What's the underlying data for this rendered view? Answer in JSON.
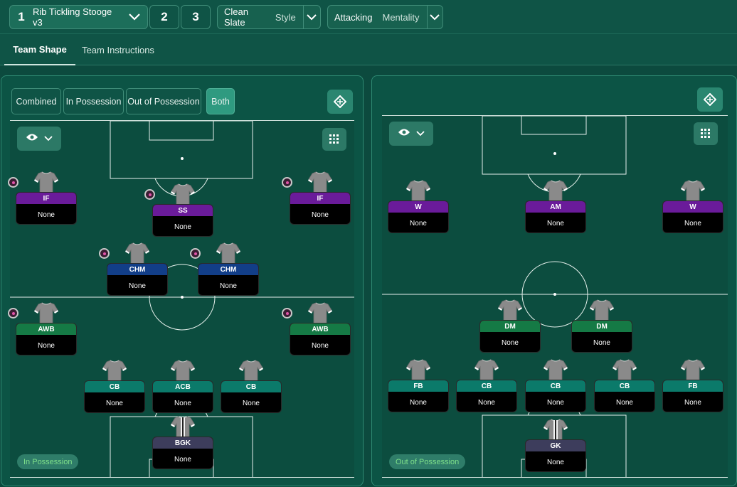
{
  "tactics": {
    "active_number": "1",
    "active_name": "Rib Tickling Stooge v3",
    "slot2": "2",
    "slot3": "3"
  },
  "style": {
    "value": "Clean Slate",
    "label": "Style"
  },
  "mentality": {
    "value": "Attacking",
    "label": "Mentality"
  },
  "tabs": [
    "Team Shape",
    "Team Instructions"
  ],
  "left_panel": {
    "segments": [
      "Combined",
      "In Possession",
      "Out of Possession",
      "Both"
    ],
    "active_segment": "Both",
    "mode_badge": "In Possession",
    "players": [
      {
        "role": "IF",
        "duty": "None",
        "color": "purple",
        "flag": true
      },
      {
        "role": "SS",
        "duty": "None",
        "color": "purple",
        "flag": true
      },
      {
        "role": "IF",
        "duty": "None",
        "color": "purple",
        "flag": true
      },
      {
        "role": "CHM",
        "duty": "None",
        "color": "blue",
        "flag": true
      },
      {
        "role": "CHM",
        "duty": "None",
        "color": "blue",
        "flag": true
      },
      {
        "role": "AWB",
        "duty": "None",
        "color": "green",
        "flag": true
      },
      {
        "role": "AWB",
        "duty": "None",
        "color": "green",
        "flag": true
      },
      {
        "role": "CB",
        "duty": "None",
        "color": "teal",
        "flag": false
      },
      {
        "role": "ACB",
        "duty": "None",
        "color": "teal",
        "flag": false
      },
      {
        "role": "CB",
        "duty": "None",
        "color": "teal",
        "flag": false
      },
      {
        "role": "BGK",
        "duty": "None",
        "color": "slate",
        "flag": false
      }
    ]
  },
  "right_panel": {
    "mode_badge": "Out of Possession",
    "players": [
      {
        "role": "W",
        "duty": "None",
        "color": "purple"
      },
      {
        "role": "AM",
        "duty": "None",
        "color": "purple"
      },
      {
        "role": "W",
        "duty": "None",
        "color": "purple"
      },
      {
        "role": "DM",
        "duty": "None",
        "color": "green"
      },
      {
        "role": "DM",
        "duty": "None",
        "color": "green"
      },
      {
        "role": "FB",
        "duty": "None",
        "color": "teal"
      },
      {
        "role": "CB",
        "duty": "None",
        "color": "teal"
      },
      {
        "role": "CB",
        "duty": "None",
        "color": "teal"
      },
      {
        "role": "CB",
        "duty": "None",
        "color": "teal"
      },
      {
        "role": "FB",
        "duty": "None",
        "color": "teal"
      },
      {
        "role": "GK",
        "duty": "None",
        "color": "slate"
      }
    ]
  },
  "icons": {
    "tactic_dropdown": "chevron-down-icon",
    "view": "eye-icon",
    "grid": "grid-icon",
    "pitch_toggle": "pitch-rotate-icon"
  },
  "colors": {
    "background": "#0c4a3e",
    "accent": "#2f9a80",
    "in_possession_text": "#7ee08a"
  }
}
